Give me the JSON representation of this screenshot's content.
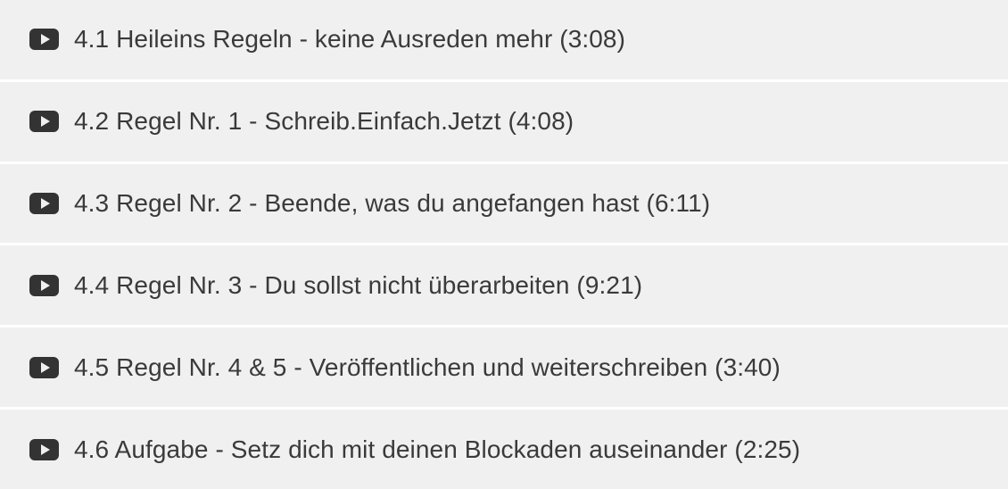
{
  "lectures": [
    {
      "icon": "play-video-icon",
      "label": "4.1 Heileins Regeln - keine Ausreden mehr (3:08)"
    },
    {
      "icon": "play-video-icon",
      "label": "4.2 Regel Nr. 1 - Schreib.Einfach.Jetzt (4:08)"
    },
    {
      "icon": "play-video-icon",
      "label": "4.3 Regel Nr. 2 - Beende, was du angefangen hast (6:11)"
    },
    {
      "icon": "play-video-icon",
      "label": "4.4 Regel Nr. 3 - Du sollst nicht überarbeiten (9:21)"
    },
    {
      "icon": "play-video-icon",
      "label": "4.5 Regel Nr. 4 & 5 - Veröffentlichen und weiterschreiben (3:40)"
    },
    {
      "icon": "play-video-icon",
      "label": "4.6 Aufgabe - Setz dich mit deinen Blockaden auseinander (2:25)"
    }
  ],
  "colors": {
    "item_background": "#f0f0f0",
    "text": "#3a3a3a",
    "icon": "#333333",
    "divider": "#ffffff"
  }
}
